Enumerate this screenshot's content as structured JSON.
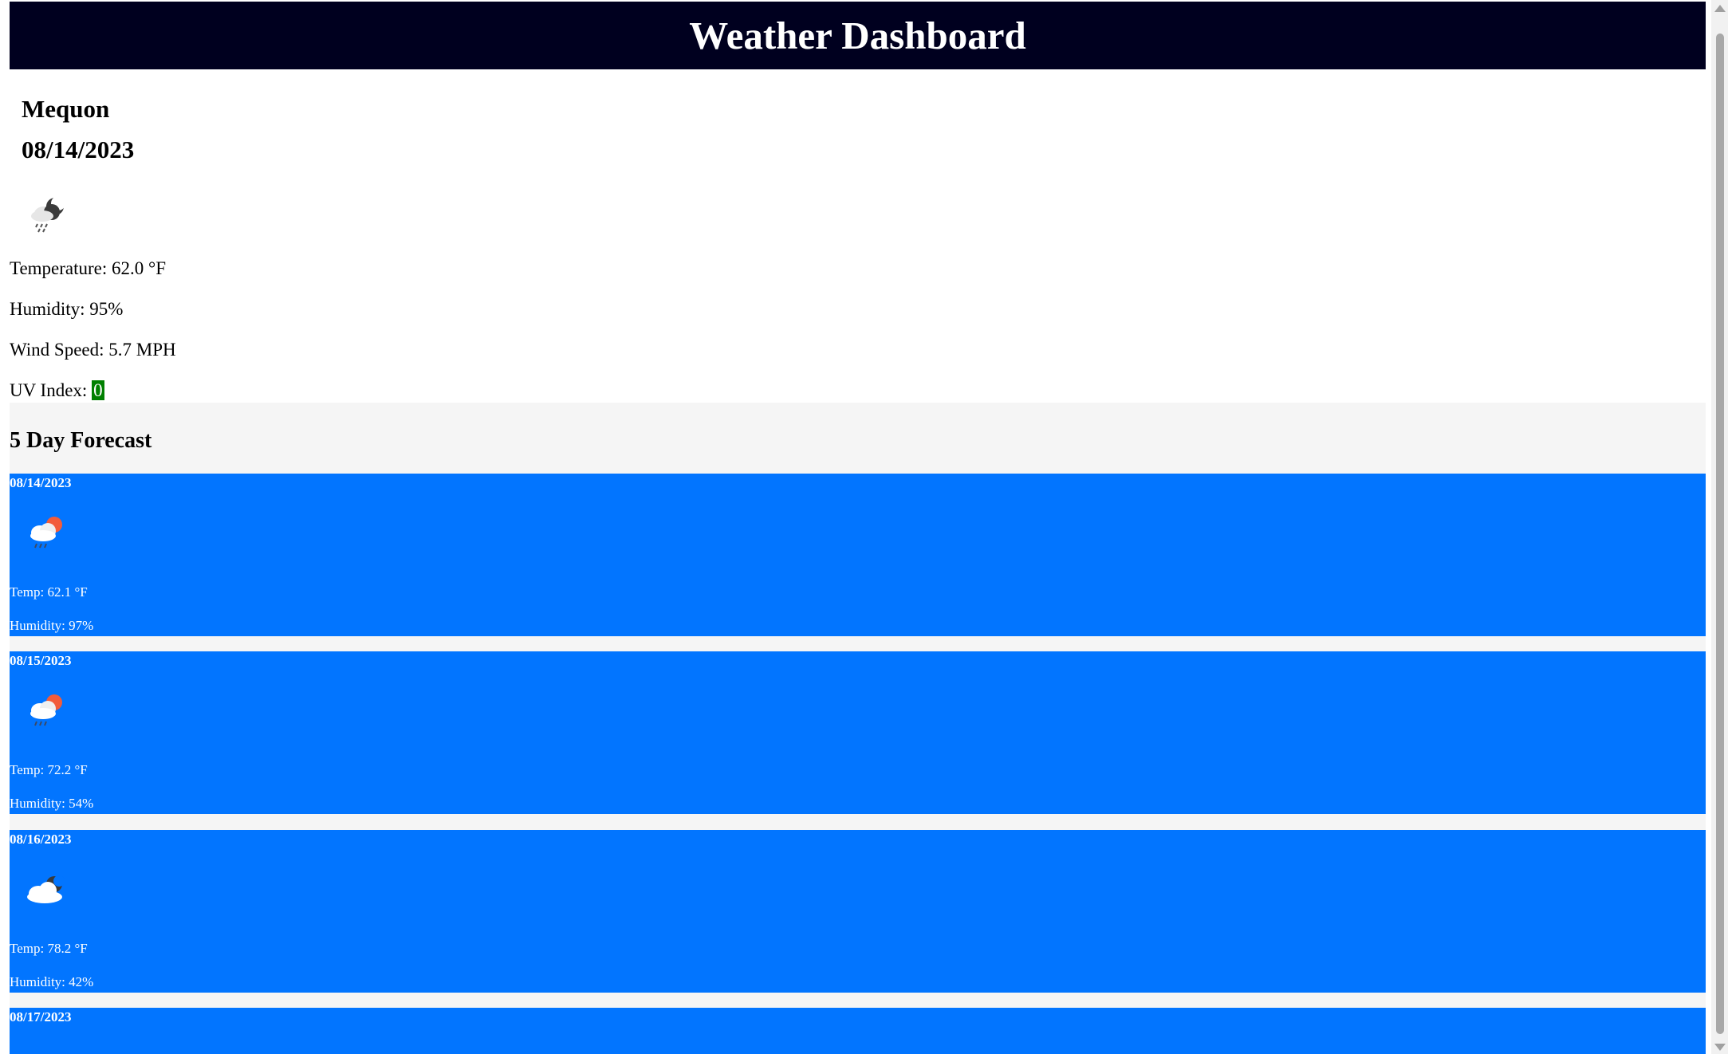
{
  "header": {
    "title": "Weather Dashboard"
  },
  "current": {
    "city": "Mequon",
    "date": "08/14/2023",
    "icon": "night-rain-cloud-icon",
    "temperature": "Temperature: 62.0 °F",
    "humidity": "Humidity: 95%",
    "wind_speed": "Wind Speed: 5.7 MPH",
    "uv_label": "UV Index: ",
    "uv_value": "0",
    "uv_color": "#008000"
  },
  "forecast": {
    "title": "5 Day Forecast",
    "card_color": "#0275ff",
    "days": [
      {
        "date": "08/14/2023",
        "icon": "sun-rain-cloud-icon",
        "temp": "Temp: 62.1 °F",
        "humidity": "Humidity: 97%"
      },
      {
        "date": "08/15/2023",
        "icon": "sun-rain-cloud-icon",
        "temp": "Temp: 72.2 °F",
        "humidity": "Humidity: 54%"
      },
      {
        "date": "08/16/2023",
        "icon": "night-cloud-icon",
        "temp": "Temp: 78.2 °F",
        "humidity": "Humidity: 42%"
      },
      {
        "date": "08/17/2023"
      }
    ]
  }
}
